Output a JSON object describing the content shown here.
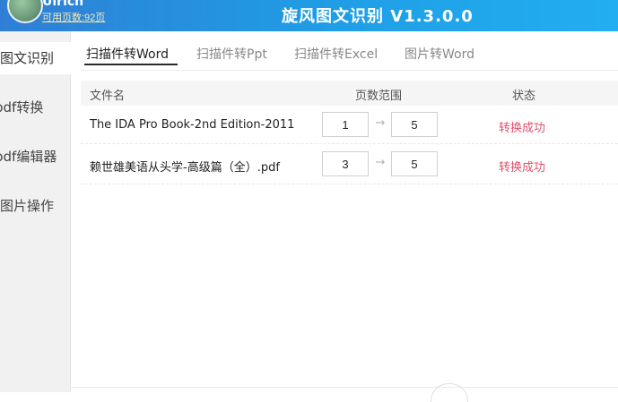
{
  "header": {
    "username": "Ulrich",
    "remaining_pages": "可用页数:92页",
    "title": "旋风图文识别 V1.3.0.0",
    "accent": "#1f9ee6"
  },
  "sidebar": {
    "items": [
      {
        "label": "图文识别",
        "active": true
      },
      {
        "label": "pdf转换",
        "active": false
      },
      {
        "label": "pdf编辑器",
        "active": false
      },
      {
        "label": "图片操作",
        "active": false
      }
    ]
  },
  "tabs": [
    {
      "label": "扫描件转Word",
      "active": true
    },
    {
      "label": "扫描件转Ppt",
      "active": false
    },
    {
      "label": "扫描件转Excel",
      "active": false
    },
    {
      "label": "图片转Word",
      "active": false
    }
  ],
  "table": {
    "headers": {
      "name": "文件名",
      "range": "页数范围",
      "status": "状态"
    },
    "rows": [
      {
        "name": "The IDA Pro Book-2nd Edition-2011",
        "from": "1",
        "to": "5",
        "status": "转换成功"
      },
      {
        "name": "赖世雄美语从头学-高级篇（全）.pdf",
        "from": "3",
        "to": "5",
        "status": "转换成功"
      }
    ],
    "status_color": "#e0506b",
    "arrow_icon": "arrow-right-icon"
  }
}
